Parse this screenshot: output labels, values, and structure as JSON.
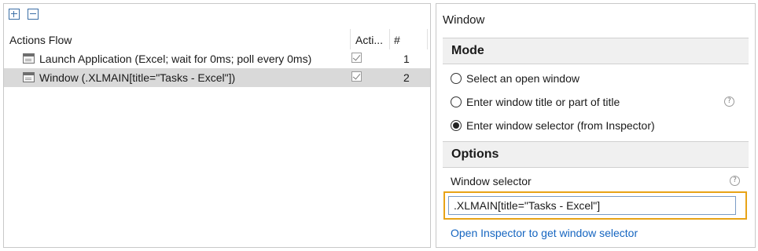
{
  "left_panel": {
    "toolbar": {
      "expand_icon": "expand-all-icon",
      "collapse_icon": "collapse-all-icon"
    },
    "columns": {
      "flow": "Actions Flow",
      "active": "Acti...",
      "number": "#"
    },
    "rows": [
      {
        "label": "Launch Application (Excel; wait for 0ms; poll every 0ms)",
        "checked": true,
        "number": "1",
        "selected": false,
        "icon": "window-icon"
      },
      {
        "label": "Window (.XLMAIN[title=\"Tasks - Excel\"])",
        "checked": true,
        "number": "2",
        "selected": true,
        "icon": "window-icon"
      }
    ]
  },
  "right_panel": {
    "title": "Window",
    "mode": {
      "header": "Mode",
      "options": [
        {
          "label": "Select an open window",
          "checked": false
        },
        {
          "label": "Enter window title or part of title",
          "checked": false,
          "help": true
        },
        {
          "label": "Enter window selector (from Inspector)",
          "checked": true
        }
      ]
    },
    "options": {
      "header": "Options",
      "window_selector_label": "Window selector",
      "window_selector_value": ".XLMAIN[title=\"Tasks - Excel\"]",
      "help_glyph": "?",
      "inspector_link": "Open Inspector to get window selector"
    },
    "colors": {
      "highlight": "#e8a317",
      "link": "#1565c0",
      "selected_row": "#d9d9d9"
    }
  }
}
